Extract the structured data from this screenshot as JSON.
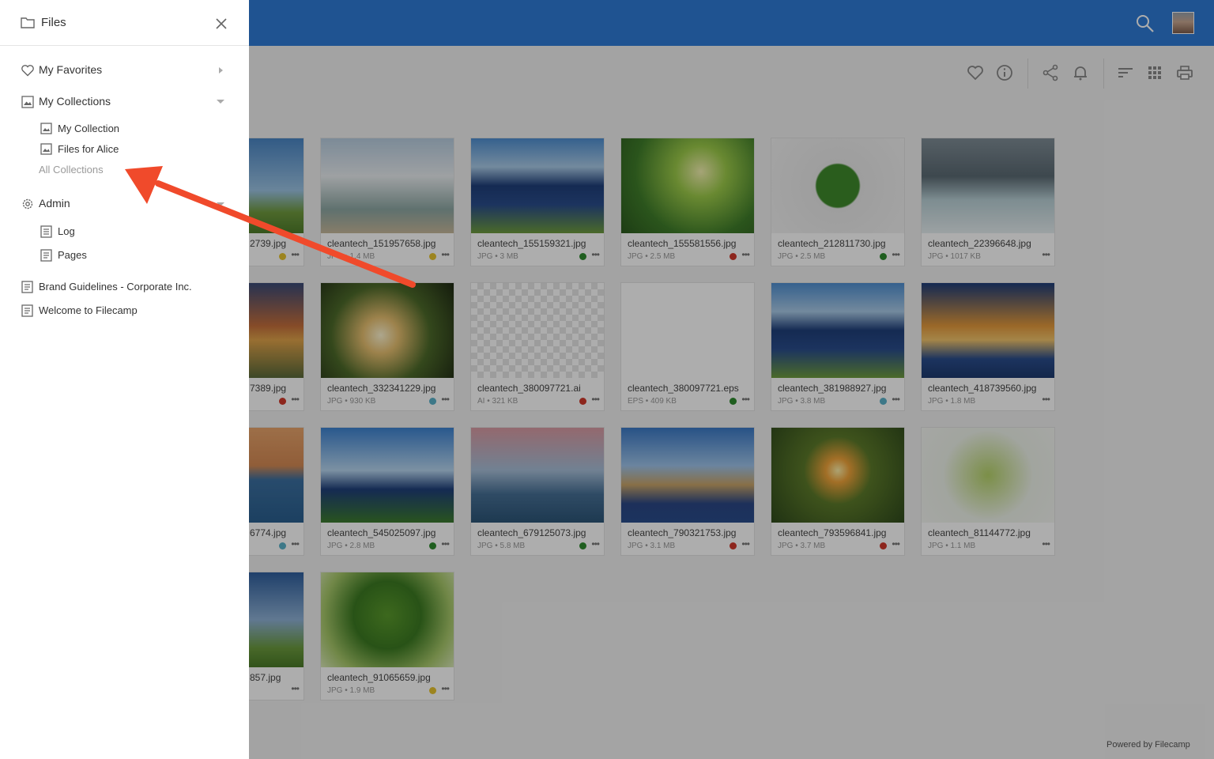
{
  "drawer": {
    "title": "Files",
    "nav": {
      "favorites": "My Favorites",
      "collections": "My Collections",
      "collection_1": "My Collection",
      "collection_2": "Files for Alice",
      "all_collections": "All Collections",
      "admin": "Admin",
      "log": "Log",
      "pages": "Pages",
      "brand": "Brand Guidelines - Corporate Inc.",
      "welcome": "Welcome to Filecamp"
    }
  },
  "footer": {
    "powered": "Powered by Filecamp"
  },
  "colors": {
    "topbar": "#2f7bd6",
    "arrow": "#f04a2b",
    "status_green": "#2e8b2e",
    "status_red": "#d0392b",
    "status_yellow": "#e6c32f",
    "status_blue": "#5bb2c9"
  },
  "files": [
    {
      "name": "2739.jpg",
      "meta": "",
      "status": "yellow",
      "partial": true
    },
    {
      "name": "cleantech_151957658.jpg",
      "meta": "JPG • 1.4 MB",
      "status": "yellow"
    },
    {
      "name": "cleantech_155159321.jpg",
      "meta": "JPG • 3 MB",
      "status": "green"
    },
    {
      "name": "cleantech_155581556.jpg",
      "meta": "JPG • 2.5 MB",
      "status": "red"
    },
    {
      "name": "cleantech_212811730.jpg",
      "meta": "JPG • 2.5 MB",
      "status": "green"
    },
    {
      "name": "cleantech_22396648.jpg",
      "meta": "JPG • 1017 KB",
      "status": "none"
    },
    {
      "name": "7389.jpg",
      "meta": "",
      "status": "red",
      "partial": true
    },
    {
      "name": "cleantech_332341229.jpg",
      "meta": "JPG • 930 KB",
      "status": "blue"
    },
    {
      "name": "cleantech_380097721.ai",
      "meta": "AI • 321 KB",
      "status": "red"
    },
    {
      "name": "cleantech_380097721.eps",
      "meta": "EPS • 409 KB",
      "status": "green"
    },
    {
      "name": "cleantech_381988927.jpg",
      "meta": "JPG • 3.8 MB",
      "status": "blue"
    },
    {
      "name": "cleantech_418739560.jpg",
      "meta": "JPG • 1.8 MB",
      "status": "none"
    },
    {
      "name": "6774.jpg",
      "meta": "",
      "status": "blue",
      "partial": true
    },
    {
      "name": "cleantech_545025097.jpg",
      "meta": "JPG • 2.8 MB",
      "status": "green"
    },
    {
      "name": "cleantech_679125073.jpg",
      "meta": "JPG • 5.8 MB",
      "status": "green"
    },
    {
      "name": "cleantech_790321753.jpg",
      "meta": "JPG • 3.1 MB",
      "status": "red"
    },
    {
      "name": "cleantech_793596841.jpg",
      "meta": "JPG • 3.7 MB",
      "status": "red"
    },
    {
      "name": "cleantech_81144772.jpg",
      "meta": "JPG • 1.1 MB",
      "status": "none"
    },
    {
      "name": "857.jpg",
      "meta": "",
      "status": "none",
      "partial": true
    },
    {
      "name": "cleantech_91065659.jpg",
      "meta": "JPG • 1.9 MB",
      "status": "yellow"
    }
  ],
  "thumbs": [
    "wind",
    "engineers",
    "solar",
    "tree",
    "power",
    "dam",
    "sunset",
    "bulb",
    "logo",
    "logo-small",
    "solar",
    "towers",
    "sea",
    "solar-wind",
    "offshore",
    "solar-wind2",
    "bulb2",
    "car",
    "wind2",
    "house"
  ],
  "more_glyph": "•••"
}
